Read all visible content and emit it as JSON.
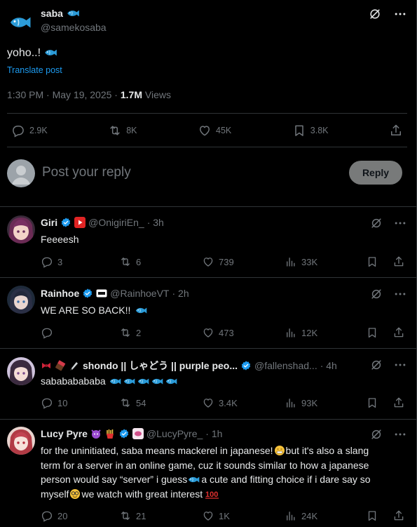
{
  "post": {
    "author_name": "saba",
    "author_handle": "@samekosaba",
    "text": "yoho..!",
    "translate_label": "Translate post",
    "timestamp": "1:30 PM · May 19, 2025 · ",
    "views_count": "1.7M",
    "views_label": " Views",
    "stats": {
      "replies": "2.9K",
      "reposts": "8K",
      "likes": "45K",
      "bookmarks": "3.8K"
    }
  },
  "reply_box": {
    "placeholder": "Post your reply",
    "button_label": "Reply"
  },
  "replies": [
    {
      "name": "Giri",
      "handle": "@OnigiriEn_",
      "time": "· 3h",
      "text": "Feeeesh",
      "replies": "3",
      "reposts": "6",
      "likes": "739",
      "views": "33K"
    },
    {
      "name": "Rainhoe",
      "handle": "@RainhoeVT",
      "time": "· 2h",
      "text": "WE ARE SO BACK!!",
      "replies": "",
      "reposts": "2",
      "likes": "473",
      "views": "12K"
    },
    {
      "name": "shondo || しゃどう || purple peo...",
      "handle": "@fallenshad...",
      "time": "· 4h",
      "text": "sabababababa",
      "replies": "10",
      "reposts": "54",
      "likes": "3.4K",
      "views": "93K"
    },
    {
      "name": "Lucy Pyre",
      "handle": "@LucyPyre_",
      "time": "· 1h",
      "text_lines": [
        "for the uninitiated, saba means mackerel in japanese!",
        "but it's also a slang",
        "term for a server in an online game, cuz it sounds similar to how a japanese",
        "person would say “server” i guess",
        "a cute and fitting choice if i dare say so",
        "myself",
        "we watch with great interest"
      ],
      "replies": "20",
      "reposts": "21",
      "likes": "1K",
      "views": "24K"
    }
  ],
  "colors": {
    "accent": "#1d9bf0",
    "muted": "#71767b",
    "text": "#e7e9ea",
    "border": "#2f3336",
    "background": "#000000"
  }
}
